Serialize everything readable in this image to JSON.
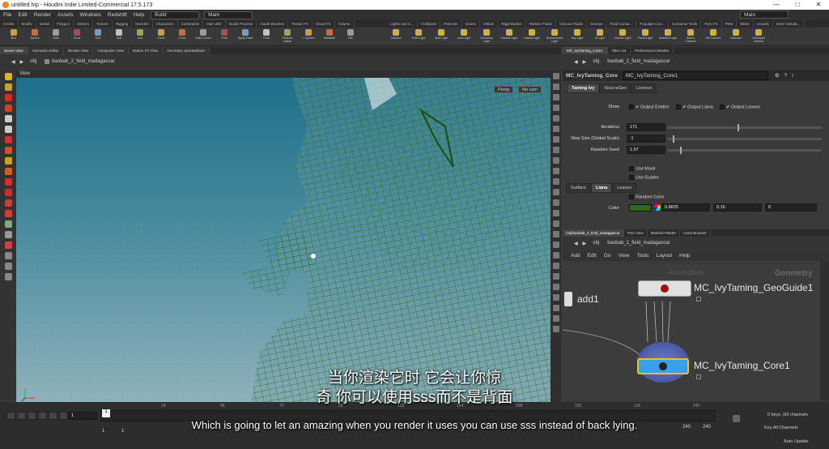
{
  "window": {
    "title": "untitled.hip - Houdini Indie Limited-Commercial 17.5.173"
  },
  "menubar": {
    "items": [
      "File",
      "Edit",
      "Render",
      "Assets",
      "Windows",
      "Redshift",
      "Help"
    ],
    "build_label": "Build",
    "desktop_label": "Main",
    "right_desktop_label": "Main"
  },
  "shelf": {
    "left_tabs": [
      "Create",
      "Modify",
      "Model",
      "Polygon",
      "Deform",
      "Texture",
      "Rigging",
      "Muscles",
      "Characters",
      "Constraints",
      "Hair Utils",
      "Guide Process",
      "Guide Brushes",
      "Terrain FX",
      "Cloud FX",
      "Volume"
    ],
    "right_tabs": [
      "Lights and C...",
      "Collisions",
      "Particles",
      "Grains",
      "Vellum",
      "Rigid Bodies",
      "Particle Fluids",
      "Viscous Fluids",
      "Oceans",
      "Fluid Contai...",
      "Populate Con...",
      "Container Tools",
      "Pyro FX",
      "FEM",
      "Wires",
      "Crowds",
      "Drive Simula..."
    ],
    "left_tools": [
      "Box",
      "Sphere",
      "Tube",
      "Torus",
      "Grid",
      "Null",
      "Line",
      "Circle",
      "Curve",
      "Draw Curve",
      "Path",
      "Spray Paint",
      "Font",
      "Platonic Solids",
      "L-System",
      "Metaball",
      "File"
    ],
    "right_tools": [
      "Camera",
      "Point Light",
      "Spot Light",
      "Area Light",
      "Geometry Light",
      "Volume Light",
      "Distant Light",
      "Environment Light",
      "Sky Light",
      "GI Light",
      "Caustic Light",
      "Portal Light",
      "Ambient Light",
      "Stereo Camera",
      "VR Camera",
      "Switcher",
      "Gamepad Camera"
    ]
  },
  "scene": {
    "tabs": [
      "Scene View",
      "Animation Editor",
      "Render View",
      "Composite View",
      "Motion FX View",
      "Geometry Spreadsheet"
    ],
    "path_context": "obj",
    "path_node": "baobab_2_field_madagascar",
    "view_label": "View",
    "persp_label": "Persp",
    "cam_label": "No cam"
  },
  "params": {
    "tabs": [
      "MC_IvyTaming_Core1",
      "Take List",
      "Performance Monitor"
    ],
    "path_context": "obj",
    "path_node": "baobab_2_field_madagascar",
    "node_type": "MC_IvyTaming_Core",
    "node_name": "MC_IvyTaming_Core1",
    "section_tabs": [
      "Taming Ivy",
      "SourceGeo",
      "Licence"
    ],
    "show_label": "Show",
    "show_checks": [
      "Output Emitter",
      "Output Liana",
      "Output Leaves"
    ],
    "iterations_label": "Iterations",
    "iterations_value": "171",
    "iterations_fraction": 0.45,
    "step_label": "Step Size (Global Scale)",
    "step_value": ".1",
    "step_fraction": 0.03,
    "seed_label": "Random Seed",
    "seed_value": "1.57",
    "seed_fraction": 0.08,
    "use_mask": "Use Mask",
    "use_guides": "Use Guides",
    "sub_tabs": [
      "Surface",
      "Liana",
      "Leaves"
    ],
    "random_color": "Random Color",
    "color_label": "Color",
    "color_values": [
      "0.8825",
      "0.15",
      "0"
    ],
    "color_swatch": "#2d6a12"
  },
  "network": {
    "tabs": [
      "/obj/baobab_2_field_madagascar",
      "Tree View",
      "Material Palette",
      "Asset Browser"
    ],
    "path_context": "obj",
    "path_node": "baobab_2_field_madagascar",
    "menu": [
      "Add",
      "Edit",
      "Go",
      "View",
      "Tools",
      "Layout",
      "Help"
    ],
    "watermark_left": "Auto Edition",
    "watermark_right": "Geometry",
    "nodes": [
      {
        "name": "add1"
      },
      {
        "name": "MC_IvyTaming_GeoGuide1"
      },
      {
        "name": "MC_IvyTaming_Core1"
      }
    ]
  },
  "timeline": {
    "frame": "1",
    "range_start": "1",
    "range_start2": "1",
    "ticks": [
      "24",
      "48",
      "72",
      "96",
      "120",
      "144",
      "168",
      "192",
      "216",
      "240"
    ],
    "end_a": "240",
    "end_b": "240",
    "keys_label": "0 keys, 0/0 channels",
    "channels_label": "Key All Channels",
    "autoupdate_label": "Auto Update"
  },
  "subtitles": {
    "zh_line1": "当你渲染它时 它会让你惊",
    "zh_line2": "奇 你可以使用sss而不是背面",
    "en": "Which is going to let an amazing when you render it uses you can use sss instead of back lying."
  },
  "colors": {
    "accent_yellow": "#f0c020",
    "wire_green": "#1e6b16",
    "node_blue": "#3aa0e8"
  }
}
